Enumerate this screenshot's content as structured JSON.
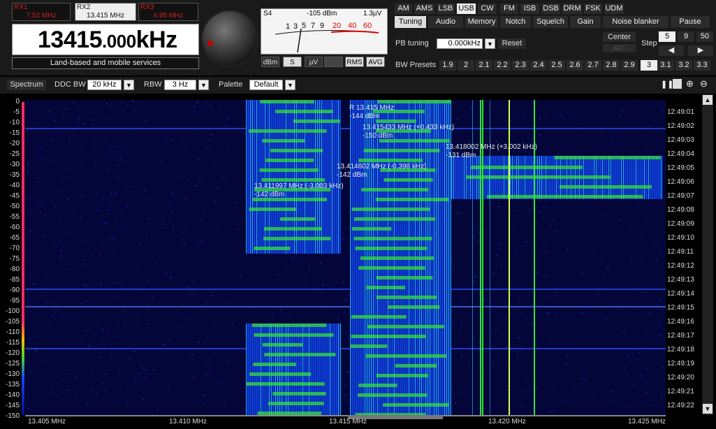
{
  "receivers": [
    {
      "name": "RX1",
      "freq": "7.52 MHz",
      "active": false
    },
    {
      "name": "RX2",
      "freq": "13.415 MHz",
      "active": true
    },
    {
      "name": "RX3",
      "freq": "6.95 MHz",
      "active": false
    }
  ],
  "frequency": {
    "main": "13415",
    "decimals": ".000",
    "unit": "kHz"
  },
  "service": "Land-based and mobile services",
  "meter": {
    "s": "S4",
    "dbm": "-105 dBm",
    "uv": "1.3µV",
    "scale": [
      "1",
      "3",
      "5",
      "7",
      "9",
      "20",
      "40",
      "60"
    ]
  },
  "meter_buttons": [
    {
      "label": "dBm",
      "selected": false
    },
    {
      "label": "S",
      "selected": true
    },
    {
      "label": "µV",
      "selected": false
    },
    {
      "label": "",
      "selected": false
    },
    {
      "label": "RMS",
      "selected": true
    },
    {
      "label": "AVG",
      "selected": true
    }
  ],
  "modes": [
    {
      "label": "AM",
      "selected": false
    },
    {
      "label": "AMS",
      "selected": false
    },
    {
      "label": "LSB",
      "selected": false
    },
    {
      "label": "USB",
      "selected": true
    },
    {
      "label": "CW",
      "selected": false
    },
    {
      "label": "FM",
      "selected": false
    },
    {
      "label": "ISB",
      "selected": false
    },
    {
      "label": "DSB",
      "selected": false
    },
    {
      "label": "DRM",
      "selected": false
    },
    {
      "label": "FSK",
      "selected": false
    },
    {
      "label": "UDM",
      "selected": false
    }
  ],
  "tabs": [
    {
      "label": "Tuning",
      "selected": true
    },
    {
      "label": "Audio",
      "selected": false
    },
    {
      "label": "Memory",
      "selected": false
    },
    {
      "label": "Notch",
      "selected": false
    },
    {
      "label": "Squelch",
      "selected": false
    },
    {
      "label": "Gain",
      "selected": false
    },
    {
      "label": "Noise blanker",
      "selected": false
    },
    {
      "label": "Pause",
      "selected": false
    }
  ],
  "pb_tuning": {
    "label": "PB tuning",
    "value": "0.000kHz",
    "reset": "Reset"
  },
  "center": {
    "label": "Center",
    "sub": "AFC"
  },
  "step": {
    "label": "Step",
    "values": [
      "5",
      "9",
      "50"
    ],
    "selected": "5"
  },
  "bw_presets": {
    "label": "BW Presets",
    "values": [
      "1.9",
      "2",
      "2.1",
      "2.2",
      "2.3",
      "2.4",
      "2.5",
      "2.6",
      "2.7",
      "2.8",
      "2.9",
      "3",
      "3.1",
      "3.2",
      "3.3"
    ],
    "selected": "3"
  },
  "spectrum_bar": {
    "spectrum": "Spectrum",
    "ddc_label": "DDC BW",
    "ddc_value": "20 kHz",
    "rbw_label": "RBW",
    "rbw_value": "3 Hz",
    "palette_label": "Palette",
    "palette_value": "Default"
  },
  "y_axis": [
    "0",
    "-5",
    "-10",
    "-15",
    "-20",
    "-25",
    "-30",
    "-35",
    "-40",
    "-45",
    "-50",
    "-55",
    "-60",
    "-65",
    "-70",
    "-75",
    "-80",
    "-85",
    "-90",
    "-95",
    "-100",
    "-105",
    "-110",
    "-115",
    "-120",
    "-125",
    "-130",
    "-135",
    "-140",
    "-145",
    "-150"
  ],
  "time_axis": [
    "12:49:01",
    "12:49:02",
    "12:49:03",
    "12:49:04",
    "12:49:05",
    "12:49:06",
    "12:49:07",
    "12:49:08",
    "12:49:09",
    "12:49:10",
    "12:49:11",
    "12:49:12",
    "12:49:13",
    "12:49:14",
    "12:49:15",
    "12:49:16",
    "12:49:17",
    "12:49:18",
    "12:49:19",
    "12:49:20",
    "12:49:21",
    "12:49:22"
  ],
  "x_axis": [
    "13.405 MHz",
    "13.410 MHz",
    "13.415 MHz",
    "13.420 MHz",
    "13.425 MHz"
  ],
  "annotations": [
    {
      "l1": "R 13.415 MHz",
      "l2": "-144 dBm"
    },
    {
      "l1": "13.415433 MHz (+0.433 kHz)",
      "l2": "-150 dBm"
    },
    {
      "l1": "13.418002 MHz (+3.002 kHz)",
      "l2": "-131 dBm"
    },
    {
      "l1": "13.414602 MHz (-0.398 kHz)",
      "l2": "-142 dBm"
    },
    {
      "l1": "13.411997 MHz (-3.003 kHz)",
      "l2": "-142 dBm"
    }
  ],
  "colors": {
    "background": "#04063a",
    "signal": "#34e23a",
    "carrier": "#d8ff50",
    "accent": "#ff2a6a"
  }
}
